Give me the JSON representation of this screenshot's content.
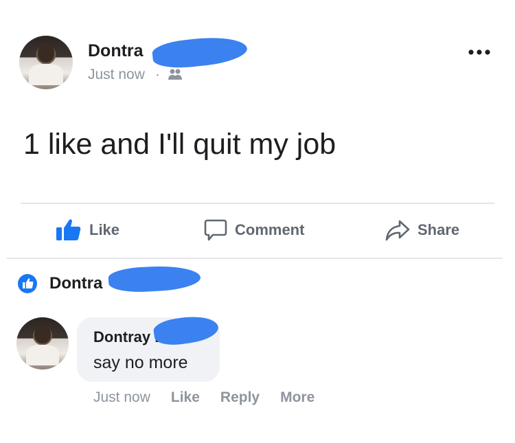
{
  "post": {
    "author": "Dontra",
    "timestamp": "Just now",
    "audience_icon": "friends-icon",
    "menu_icon": "more-dots-icon",
    "text": "1 like and I'll quit my job"
  },
  "actions": {
    "like_label": "Like",
    "comment_label": "Comment",
    "share_label": "Share"
  },
  "reactions": {
    "liked_by": "Dontra",
    "icon": "like-badge-icon"
  },
  "comment": {
    "author": "Dontray L",
    "text": "say no more",
    "timestamp": "Just now",
    "like_label": "Like",
    "reply_label": "Reply",
    "more_label": "More"
  },
  "colors": {
    "facebook_blue": "#1877f2",
    "scribble_blue": "#3b82f0"
  }
}
